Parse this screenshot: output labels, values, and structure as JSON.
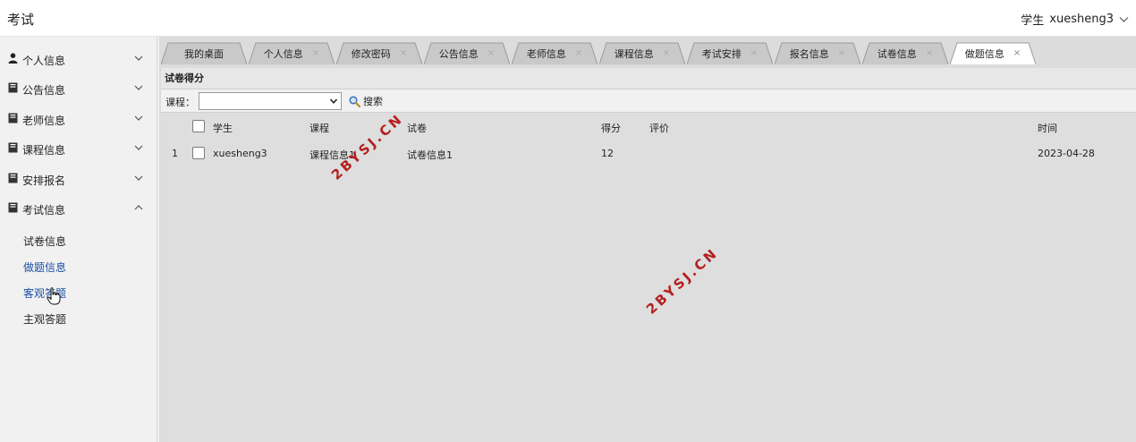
{
  "app": {
    "title": "考试",
    "user_role": "学生",
    "username": "xuesheng3"
  },
  "sidebar": {
    "groups": [
      {
        "label": "个人信息",
        "icon": "user-icon",
        "expanded": false
      },
      {
        "label": "公告信息",
        "icon": "book-icon",
        "expanded": false
      },
      {
        "label": "老师信息",
        "icon": "book-icon",
        "expanded": false
      },
      {
        "label": "课程信息",
        "icon": "book-icon",
        "expanded": false
      },
      {
        "label": "安排报名",
        "icon": "book-icon",
        "expanded": false
      },
      {
        "label": "考试信息",
        "icon": "book-icon",
        "expanded": true
      }
    ],
    "exam_subitems": [
      "试卷信息",
      "做题信息",
      "客观答题",
      "主观答题"
    ],
    "active_subitem": "做题信息"
  },
  "tabs": [
    {
      "label": "我的桌面",
      "closable": false
    },
    {
      "label": "个人信息",
      "closable": true
    },
    {
      "label": "修改密码",
      "closable": true
    },
    {
      "label": "公告信息",
      "closable": true
    },
    {
      "label": "老师信息",
      "closable": true
    },
    {
      "label": "课程信息",
      "closable": true
    },
    {
      "label": "考试安排",
      "closable": true
    },
    {
      "label": "报名信息",
      "closable": true
    },
    {
      "label": "试卷信息",
      "closable": true
    },
    {
      "label": "做题信息",
      "closable": true,
      "active": true
    }
  ],
  "tab_close_glyph": "×",
  "panel": {
    "title": "试卷得分",
    "filter_label": "课程：",
    "course_value": "",
    "search_label": "搜索"
  },
  "table": {
    "columns": [
      "学生",
      "课程",
      "试卷",
      "得分",
      "评价",
      "时间"
    ],
    "rows": [
      {
        "index": "1",
        "student": "xuesheng3",
        "course": "课程信息1",
        "paper": "试卷信息1",
        "score": "12",
        "comment": "",
        "time": "2023-04-28"
      }
    ]
  },
  "watermark": "2BYSJ.CN",
  "colors": {
    "active_link": "#1a4fa3",
    "watermark": "#b32020"
  }
}
